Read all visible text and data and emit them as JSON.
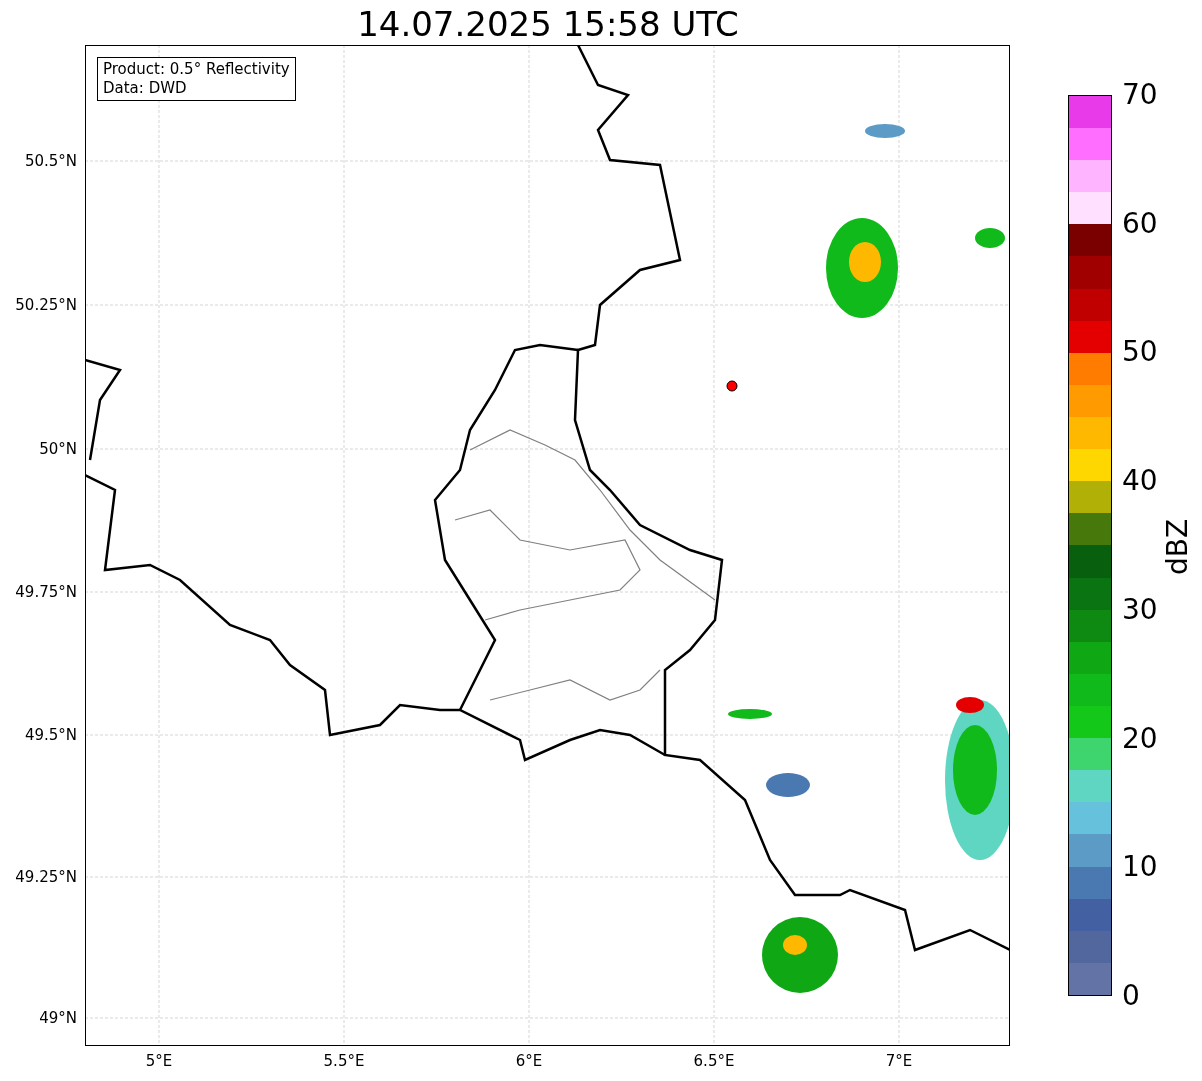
{
  "title": "14.07.2025 15:58 UTC",
  "info_box": [
    "Product: 0.5° Reflectivity",
    "Data: DWD"
  ],
  "lat_ticks": [
    "50.5°N",
    "50.25°N",
    "50°N",
    "49.75°N",
    "49.5°N",
    "49.25°N",
    "49°N"
  ],
  "lon_ticks": [
    "5°E",
    "5.5°E",
    "6°E",
    "6.5°E",
    "7°E"
  ],
  "colorbar": {
    "label": "dBZ",
    "ticks": [
      "70",
      "60",
      "50",
      "40",
      "30",
      "20",
      "10",
      "0"
    ],
    "segments": [
      {
        "color": "#6473a5"
      },
      {
        "color": "#53679f"
      },
      {
        "color": "#4361a2"
      },
      {
        "color": "#4a79b2"
      },
      {
        "color": "#5b9bc5"
      },
      {
        "color": "#66c2dc"
      },
      {
        "color": "#5fd6c2"
      },
      {
        "color": "#3ed46e"
      },
      {
        "color": "#14c81a"
      },
      {
        "color": "#10ba1a"
      },
      {
        "color": "#0fa814"
      },
      {
        "color": "#0e8a12"
      },
      {
        "color": "#0a7412"
      },
      {
        "color": "#08600e"
      },
      {
        "color": "#47780c"
      },
      {
        "color": "#b0b006"
      },
      {
        "color": "#ffd700"
      },
      {
        "color": "#ffb800"
      },
      {
        "color": "#ff9a00"
      },
      {
        "color": "#ff7c00"
      },
      {
        "color": "#e40000"
      },
      {
        "color": "#c00000"
      },
      {
        "color": "#a00000"
      },
      {
        "color": "#7a0000"
      },
      {
        "color": "#ffe0ff"
      },
      {
        "color": "#ffb4ff"
      },
      {
        "color": "#ff6eff"
      },
      {
        "color": "#e83ae8"
      }
    ]
  }
}
